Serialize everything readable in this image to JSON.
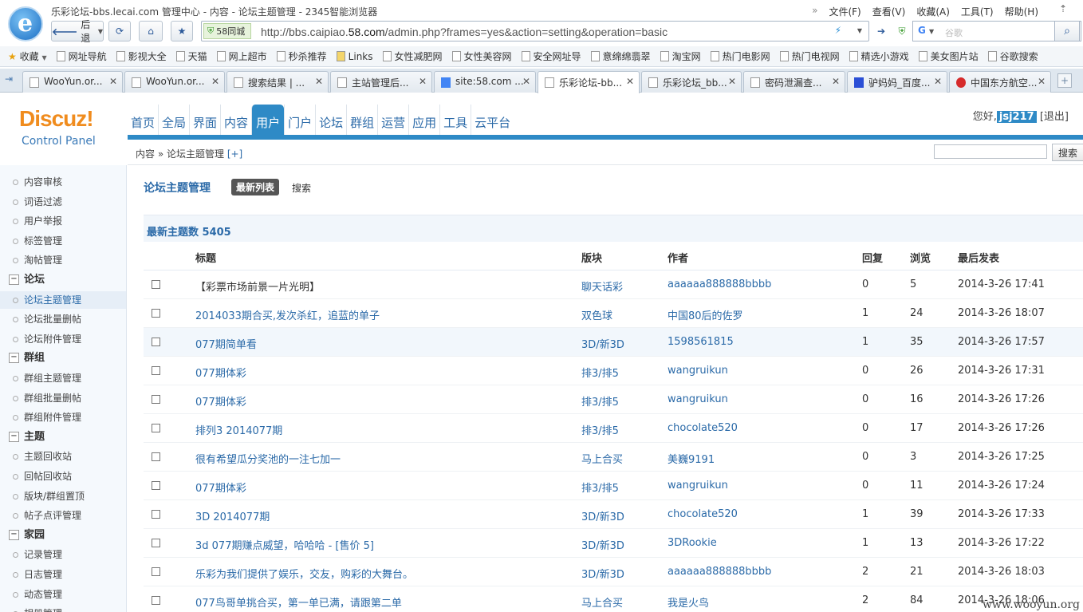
{
  "window": {
    "title": "乐彩论坛-bbs.lecai.com 管理中心 - 内容 - 论坛主题管理 - 2345智能浏览器",
    "menus": [
      "文件(F)",
      "查看(V)",
      "收藏(A)",
      "工具(T)",
      "帮助(H)"
    ]
  },
  "navbar": {
    "back_label": "后退",
    "site_badge": "58同城",
    "url_prefix": "http://bbs.caipiao.",
    "url_domain": "58.com",
    "url_suffix": "/admin.php?frames=yes&action=setting&operation=basic",
    "search_placeholder": "谷歌"
  },
  "bookmarks": [
    "收藏",
    "网址导航",
    "影视大全",
    "天猫",
    "网上超市",
    "秒杀推荐",
    "Links",
    "女性减肥网",
    "女性美容网",
    "安全网址导",
    "意绵绵翡翠",
    "淘宝网",
    "热门电影网",
    "热门电视网",
    "精选小游戏",
    "美女图片站",
    "谷歌搜索"
  ],
  "tabs": [
    "WooYun.or...",
    "WooYun.or...",
    "搜索结果 | ...",
    "主站管理后...",
    "site:58.com ...",
    "乐彩论坛-bb...",
    "乐彩论坛_bb...",
    "密码泄漏查...",
    "驴妈妈_百度...",
    "中国东方航空..."
  ],
  "header": {
    "logo": "Discuz!",
    "logo_sub": "Control Panel",
    "nav": [
      "首页",
      "全局",
      "界面",
      "内容",
      "用户",
      "门户",
      "论坛",
      "群组",
      "运营",
      "应用",
      "工具",
      "云平台"
    ],
    "greeting": "您好,",
    "username": "jsj217",
    "logout": "[退出]",
    "breadcrumb": "内容 » 论坛主题管理",
    "breadcrumb_add": "[+]",
    "search_button": "搜索"
  },
  "sidebar": {
    "items": [
      {
        "type": "item",
        "label": "内容审核"
      },
      {
        "type": "item",
        "label": "词语过滤"
      },
      {
        "type": "item",
        "label": "用户举报"
      },
      {
        "type": "item",
        "label": "标签管理"
      },
      {
        "type": "item",
        "label": "淘帖管理"
      },
      {
        "type": "group",
        "label": "论坛"
      },
      {
        "type": "item",
        "label": "论坛主题管理",
        "active": true
      },
      {
        "type": "item",
        "label": "论坛批量删帖"
      },
      {
        "type": "item",
        "label": "论坛附件管理"
      },
      {
        "type": "group",
        "label": "群组"
      },
      {
        "type": "item",
        "label": "群组主题管理"
      },
      {
        "type": "item",
        "label": "群组批量删帖"
      },
      {
        "type": "item",
        "label": "群组附件管理"
      },
      {
        "type": "group",
        "label": "主题"
      },
      {
        "type": "item",
        "label": "主题回收站"
      },
      {
        "type": "item",
        "label": "回帖回收站"
      },
      {
        "type": "item",
        "label": "版块/群组置顶"
      },
      {
        "type": "item",
        "label": "帖子点评管理"
      },
      {
        "type": "group",
        "label": "家园"
      },
      {
        "type": "item",
        "label": "记录管理"
      },
      {
        "type": "item",
        "label": "日志管理"
      },
      {
        "type": "item",
        "label": "动态管理"
      },
      {
        "type": "item",
        "label": "相册管理"
      }
    ]
  },
  "main": {
    "title": "论坛主题管理",
    "tab_latest": "最新列表",
    "tab_search": "搜索",
    "count_label": "最新主题数  5405",
    "columns": [
      "标题",
      "版块",
      "作者",
      "回复",
      "浏览",
      "最后发表"
    ],
    "rows": [
      {
        "title": "【彩票市场前景一片光明】",
        "forum": "聊天话彩",
        "author": "aaaaaa888888bbbb",
        "replies": "0",
        "views": "5",
        "last": "2014-3-26 17:41",
        "title_link": false
      },
      {
        "title": "2014033期合买,发次杀红，追蓝的单子",
        "forum": "双色球",
        "author": "中国80后的佐罗",
        "replies": "1",
        "views": "24",
        "last": "2014-3-26 18:07",
        "title_link": true
      },
      {
        "title": "077期简单看",
        "forum": "3D/新3D",
        "author": "1598561815",
        "replies": "1",
        "views": "35",
        "last": "2014-3-26 17:57",
        "title_link": true,
        "highlight": true
      },
      {
        "title": "077期体彩",
        "forum": "排3/排5",
        "author": "wangruikun",
        "replies": "0",
        "views": "26",
        "last": "2014-3-26 17:31",
        "title_link": true
      },
      {
        "title": "077期体彩",
        "forum": "排3/排5",
        "author": "wangruikun",
        "replies": "0",
        "views": "16",
        "last": "2014-3-26 17:26",
        "title_link": true
      },
      {
        "title": "排列3 2014077期",
        "forum": "排3/排5",
        "author": "chocolate520",
        "replies": "0",
        "views": "17",
        "last": "2014-3-26 17:26",
        "title_link": true
      },
      {
        "title": "很有希望瓜分奖池的一注七加一",
        "forum": "马上合买",
        "author": "美巍9191",
        "replies": "0",
        "views": "3",
        "last": "2014-3-26 17:25",
        "title_link": true
      },
      {
        "title": "077期体彩",
        "forum": "排3/排5",
        "author": "wangruikun",
        "replies": "0",
        "views": "11",
        "last": "2014-3-26 17:24",
        "title_link": true
      },
      {
        "title": "3D 2014077期",
        "forum": "3D/新3D",
        "author": "chocolate520",
        "replies": "1",
        "views": "39",
        "last": "2014-3-26 17:33",
        "title_link": true
      },
      {
        "title": "3d 077期赚点威望，哈哈哈 - [售价 5]",
        "forum": "3D/新3D",
        "author": "3DRookie",
        "replies": "1",
        "views": "13",
        "last": "2014-3-26 17:22",
        "title_link": true
      },
      {
        "title": "乐彩为我们提供了娱乐，交友，购彩的大舞台。",
        "forum": "3D/新3D",
        "author": "aaaaaa888888bbbb",
        "replies": "2",
        "views": "21",
        "last": "2014-3-26 18:03",
        "title_link": true
      },
      {
        "title": "077鸟哥单挑合买，第一单已满，请跟第二单",
        "forum": "马上合买",
        "author": "我是火鸟",
        "replies": "2",
        "views": "84",
        "last": "2014-3-26 18:06",
        "title_link": true
      }
    ]
  },
  "watermark": "www.wooyun.org",
  "colors": {
    "accent": "#2e8ac6",
    "link": "#2b6aa8",
    "logo": "#f08c1e"
  }
}
